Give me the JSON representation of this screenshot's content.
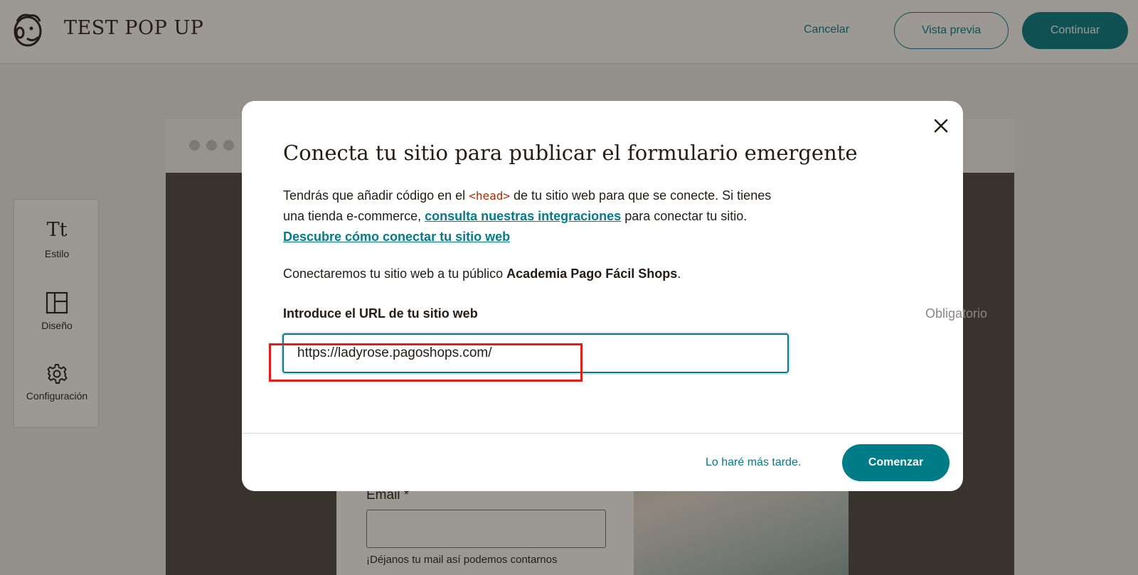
{
  "header": {
    "title": "TEST POP UP",
    "cancel_label": "Cancelar",
    "preview_label": "Vista previa",
    "continue_label": "Continuar",
    "logo_icon": "mailchimp-freddie-icon",
    "accent_color": "#007c89"
  },
  "sidebar": {
    "items": [
      {
        "label": "Estilo",
        "glyph": "Tt",
        "icon": "text-style-icon"
      },
      {
        "label": "Diseño",
        "icon": "layout-icon"
      },
      {
        "label": "Configuración",
        "icon": "gear-icon"
      }
    ]
  },
  "preview": {
    "email_label": "Email *",
    "email_helper": "¡Déjanos tu mail así podemos contarnos"
  },
  "modal": {
    "title": "Conecta tu sitio para publicar el formulario emergente",
    "desc_part1": "Tendrás que añadir código en el ",
    "desc_code": "<head>",
    "desc_part2": " de tu sitio web para que se conecte. Si tienes una tienda e-commerce, ",
    "desc_link1": "consulta nuestras integraciones",
    "desc_part3": " para conectar tu sitio. ",
    "desc_link2": "Descubre cómo conectar tu sitio web",
    "audience_prefix": "Conectaremos tu sitio web a tu público ",
    "audience_name": "Academia Pago Fácil Shops",
    "audience_suffix": ".",
    "url_label": "Introduce el URL de tu sitio web",
    "url_required": "Obligatorio",
    "url_value": "https://ladyrose.pagoshops.com/",
    "later_label": "Lo haré más tarde.",
    "start_label": "Comenzar",
    "highlight_color": "#e81b1b"
  }
}
